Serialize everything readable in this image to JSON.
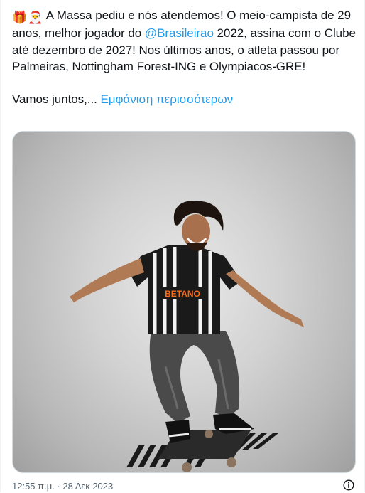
{
  "tweet": {
    "emoji_gift": "🎁",
    "emoji_santa": "🎅",
    "text_1": " A Massa pediu e nós atendemos! O meio-campista de 29 anos, melhor jogador do ",
    "mention": "@Brasileirao",
    "text_2": " 2022, assina com o Clube até dezembro de 2027! Nos últimos anos, o atleta passou por Palmeiras, Nottingham Forest-ING e Olympiacos-GRE!",
    "text_3": "Vamos juntos,... ",
    "show_more": "Εμφάνιση περισσότερων"
  },
  "media": {
    "jersey_sponsor": "BETANO"
  },
  "footer": {
    "timestamp": "12:55 π.μ. · 28 Δεκ 2023"
  },
  "colors": {
    "link": "#1d9bf0",
    "text": "#0f1419",
    "secondary": "#536471"
  },
  "icons": {
    "info": "info-circle-icon"
  }
}
